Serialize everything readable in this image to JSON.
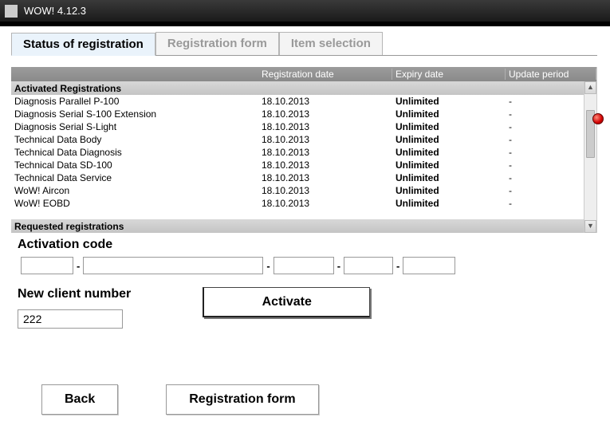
{
  "window": {
    "title": "WOW! 4.12.3"
  },
  "tabs": [
    {
      "label": "Status of registration",
      "active": true
    },
    {
      "label": "Registration form",
      "active": false
    },
    {
      "label": "Item selection",
      "active": false
    }
  ],
  "table": {
    "headers": {
      "name": "",
      "date": "Registration date",
      "expiry": "Expiry date",
      "update": "Update period"
    },
    "section_activated": "Activated Registrations",
    "section_requested": "Requested registrations",
    "rows": [
      {
        "name": "Diagnosis Parallel P-100",
        "date": "18.10.2013",
        "expiry": "Unlimited",
        "update": "-"
      },
      {
        "name": "Diagnosis Serial S-100 Extension",
        "date": "18.10.2013",
        "expiry": "Unlimited",
        "update": "-"
      },
      {
        "name": "Diagnosis Serial S-Light",
        "date": "18.10.2013",
        "expiry": "Unlimited",
        "update": "-"
      },
      {
        "name": "Technical Data Body",
        "date": "18.10.2013",
        "expiry": "Unlimited",
        "update": "-"
      },
      {
        "name": "Technical Data Diagnosis",
        "date": "18.10.2013",
        "expiry": "Unlimited",
        "update": "-"
      },
      {
        "name": "Technical Data SD-100",
        "date": "18.10.2013",
        "expiry": "Unlimited",
        "update": "-"
      },
      {
        "name": "Technical Data Service",
        "date": "18.10.2013",
        "expiry": "Unlimited",
        "update": "-"
      },
      {
        "name": "WoW! Aircon",
        "date": "18.10.2013",
        "expiry": "Unlimited",
        "update": "-"
      },
      {
        "name": "WoW! EOBD",
        "date": "18.10.2013",
        "expiry": "Unlimited",
        "update": "-"
      }
    ]
  },
  "form": {
    "activation_label": "Activation code",
    "client_label": "New client number",
    "client_value": "222",
    "activate_label": "Activate",
    "code_parts": [
      "",
      "",
      "",
      "",
      ""
    ]
  },
  "buttons": {
    "back": "Back",
    "registration_form": "Registration form"
  }
}
